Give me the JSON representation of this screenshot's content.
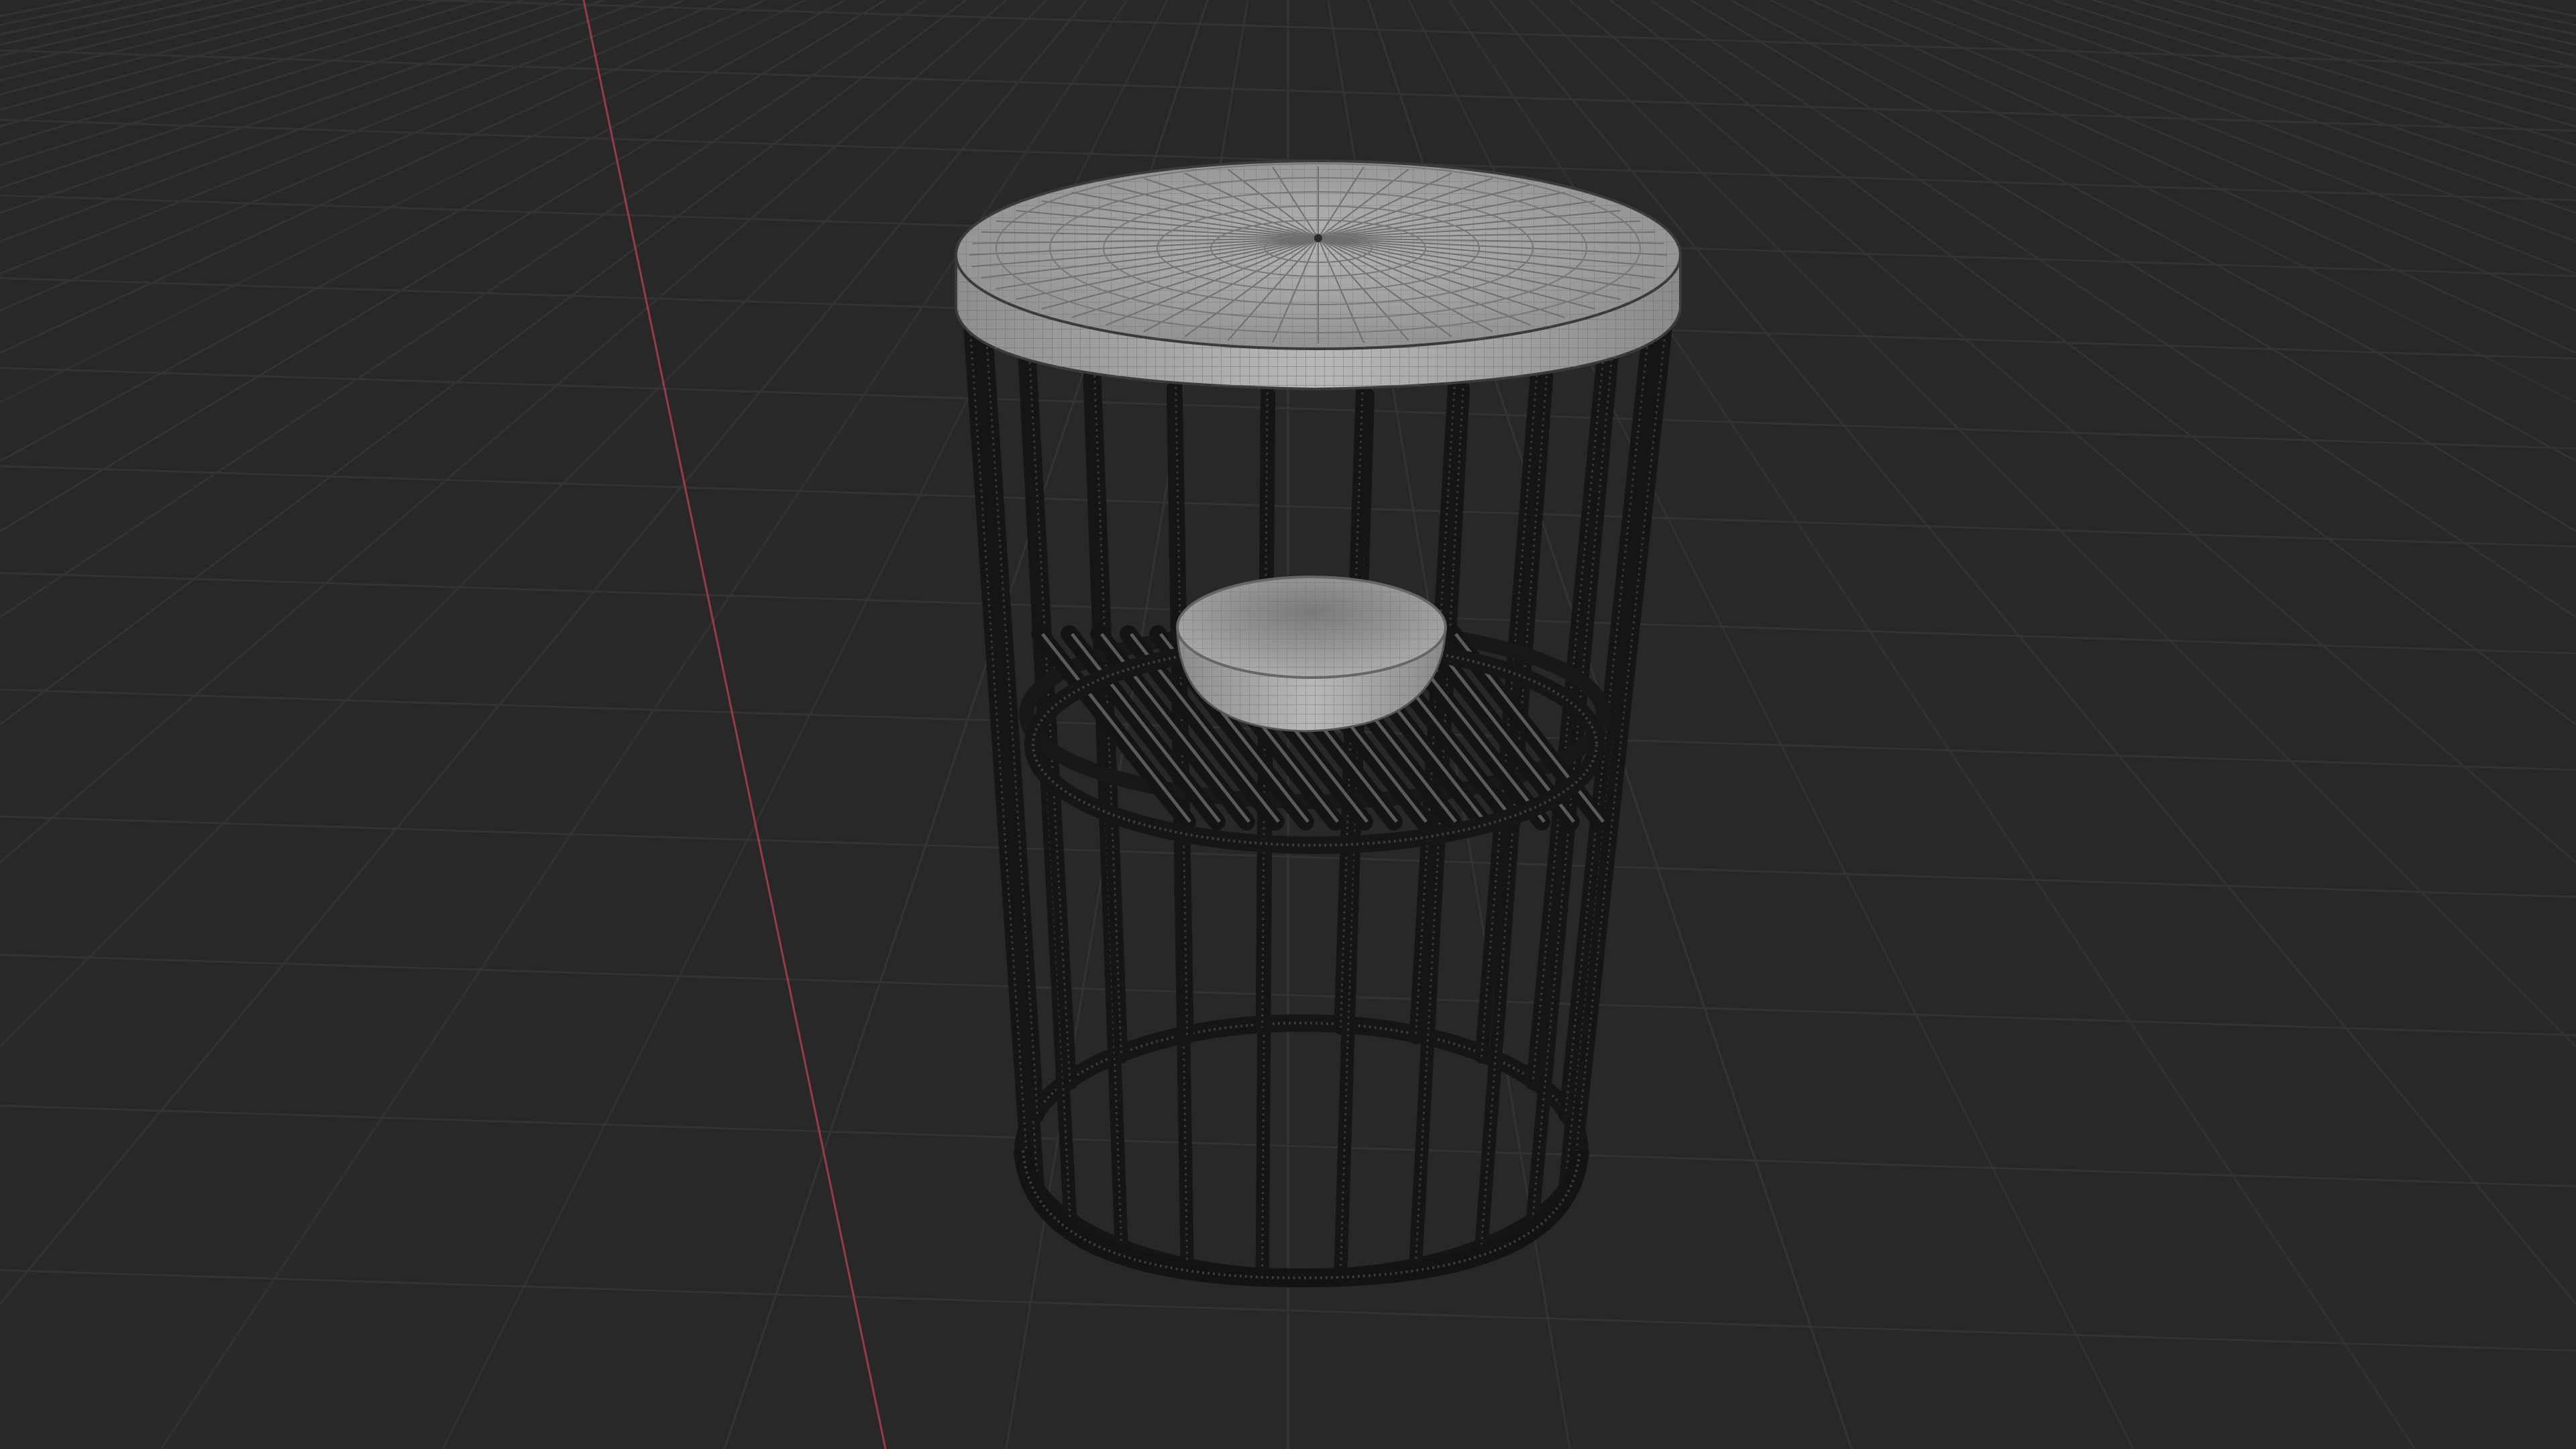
{
  "viewport": {
    "background": "#282828",
    "grid_color": "#333333",
    "x_axis_color": "#b04050"
  },
  "scene": {
    "object": "side-table",
    "parts": [
      "table-top",
      "vertical-bars",
      "middle-shelf-ring",
      "shelf-slats",
      "bowl",
      "base-ring"
    ],
    "wire_color": "#1a1a1a",
    "top_color": "#a8a8a8",
    "bowl_color": "#a0a0a0",
    "display_mode": "wireframe-overlay"
  }
}
